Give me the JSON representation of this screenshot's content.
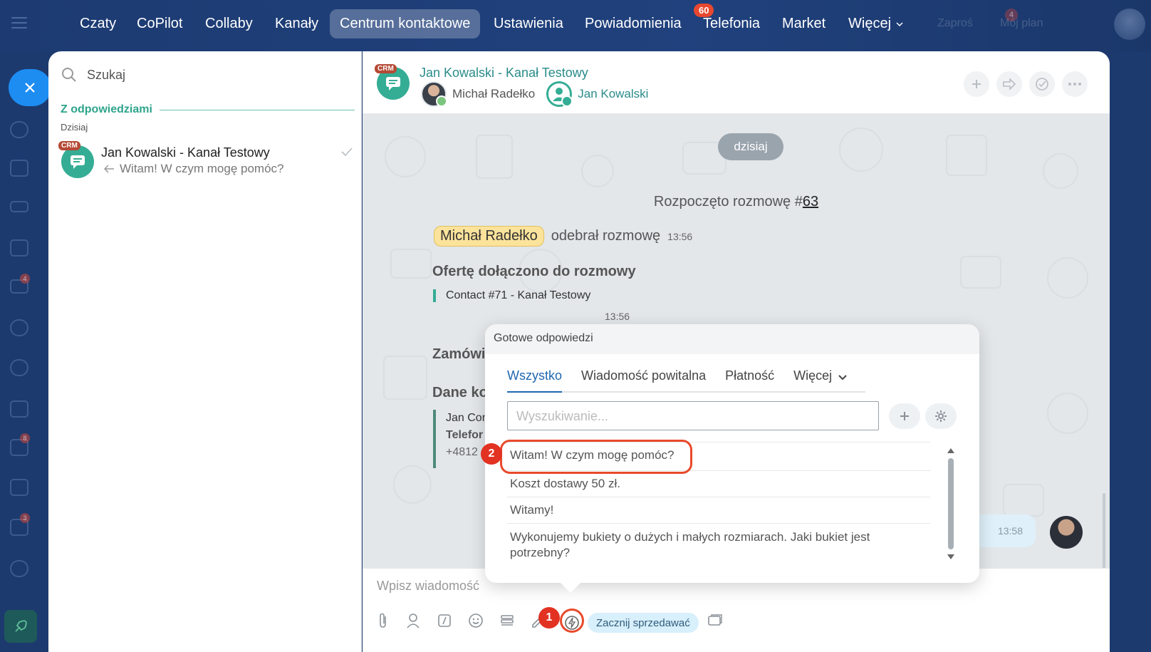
{
  "topnav": {
    "items": [
      "Czaty",
      "CoPilot",
      "Collaby",
      "Kanały",
      "Centrum kontaktowe",
      "Ustawienia",
      "Powiadomienia",
      "Telefonia",
      "Market",
      "Więcej"
    ],
    "active": "Centrum kontaktowe",
    "notifications_badge": "60",
    "right_items": [
      "Zaproś",
      "Mój plan"
    ],
    "invite_badge": "4"
  },
  "rail": {
    "badges": [
      "4",
      "8",
      "3"
    ]
  },
  "list": {
    "search_label": "Szukaj",
    "section": "Z odpowiedziami",
    "date": "Dzisiaj",
    "conversation": {
      "tag": "CRM",
      "title": "Jan Kowalski - Kanał Testowy",
      "last_message": "Witam! W czym mogę pomóc?"
    }
  },
  "chat": {
    "tag": "CRM",
    "title": "Jan Kowalski - Kanał Testowy",
    "users": [
      "Michał Radełko",
      "Jan Kowalski"
    ],
    "date_pill": "dzisiaj",
    "started_text": "Rozpoczęto rozmowę #",
    "started_number": "63",
    "accepted_name": "Michał Radełko",
    "accepted_text": "odebrał rozmowę",
    "accepted_time": "13:56",
    "offer_heading": "Ofertę dołączono do rozmowy",
    "offer_contact": "Contact #71 - Kanał Testowy",
    "offer_time": "13:56",
    "order_heading_partial": "Zamówi",
    "data_heading_partial": "Dane ko",
    "data_lines_partial": [
      "Jan Con",
      "Telefor",
      "+4812"
    ],
    "outgoing_time": "13:58",
    "composer_placeholder": "Wpisz wiadomość",
    "sell_button": "Zacznij sprzedawać"
  },
  "popup": {
    "title": "Gotowe odpowiedzi",
    "tabs": [
      "Wszystko",
      "Wiadomość powitalna",
      "Płatność",
      "Więcej"
    ],
    "active_tab": "Wszystko",
    "search_placeholder": "Wyszukiwanie...",
    "answers": [
      "Witam! W czym mogę pomóc?",
      "Koszt dostawy 50 zł.",
      "Witamy!",
      "Wykonujemy bukiety o dużych i małych rozmiarach. Jaki bukiet jest potrzebny?"
    ]
  },
  "markers": [
    "1",
    "2"
  ],
  "colors": {
    "topbar": "#1d3b72",
    "accent_teal": "#35ad95",
    "crm_tag": "#b54a35",
    "highlight_red": "#e84a2b",
    "active_tab_blue": "#2067b0"
  }
}
